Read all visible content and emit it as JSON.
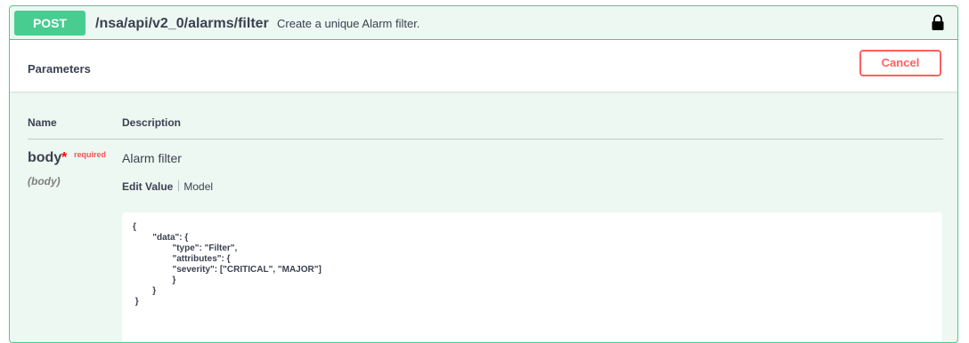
{
  "operation": {
    "method": "POST",
    "path": "/nsa/api/v2_0/alarms/filter",
    "summary": "Create a unique Alarm filter.",
    "lock_icon": "lock-icon"
  },
  "parameters": {
    "title": "Parameters",
    "cancel_label": "Cancel",
    "columns": {
      "name": "Name",
      "description": "Description"
    },
    "body_param": {
      "name": "body",
      "required_marker": "*",
      "required_label": "required",
      "location": "(body)",
      "description": "Alarm filter",
      "tabs": {
        "edit_value": "Edit Value",
        "model": "Model"
      },
      "value_lines": [
        "{",
        "        \"data\": {",
        "                \"type\": \"Filter\",",
        "                \"attributes\": {",
        "                \"severity\": [\"CRITICAL\", \"MAJOR\"]",
        "                }",
        "        }",
        " }"
      ]
    }
  },
  "colors": {
    "post_green": "#49cc90",
    "block_bg": "#edf8f2",
    "cancel_red": "#ff6060",
    "required_red": "#ff0000"
  }
}
